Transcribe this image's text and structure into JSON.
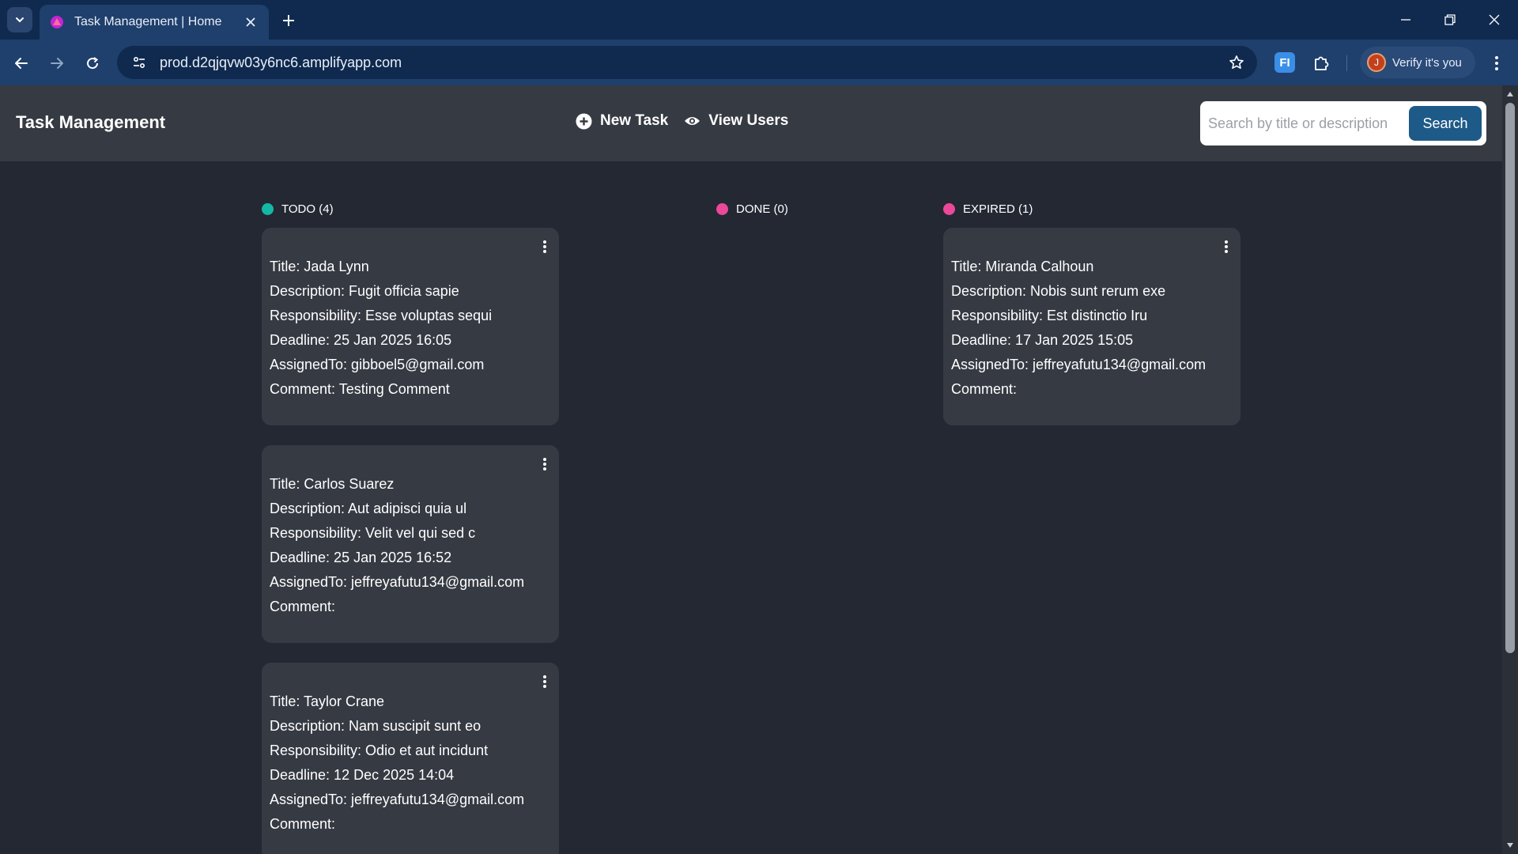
{
  "browser": {
    "tab_title": "Task Management | Home",
    "url": "prod.d2qjqvw03y6nc6.amplifyapp.com",
    "profile_label": "Verify it's you",
    "profile_initial": "J",
    "extension_label": "FI"
  },
  "app": {
    "title": "Task Management",
    "nav": {
      "new_task": "New Task",
      "view_users": "View Users"
    },
    "search": {
      "placeholder": "Search by title or description",
      "button": "Search"
    }
  },
  "columns": {
    "todo": {
      "label": "TODO (4)",
      "color": "#14b8a6"
    },
    "done": {
      "label": "DONE (0)",
      "color": "#ec4899"
    },
    "expired": {
      "label": "EXPIRED (1)",
      "color": "#ec4899"
    }
  },
  "cards": {
    "todo_1": {
      "title": "Title: Jada Lynn",
      "description": "Description: Fugit officia sapie",
      "responsibility": "Responsibility: Esse voluptas sequi",
      "deadline": "Deadline: 25 Jan 2025 16:05",
      "assigned": "AssignedTo: gibboel5@gmail.com",
      "comment": "Comment: Testing Comment"
    },
    "todo_2": {
      "title": "Title: Carlos Suarez",
      "description": "Description: Aut adipisci quia ul",
      "responsibility": "Responsibility: Velit vel qui sed c",
      "deadline": "Deadline: 25 Jan 2025 16:52",
      "assigned": "AssignedTo: jeffreyafutu134@gmail.com",
      "comment": "Comment:"
    },
    "todo_3": {
      "title": "Title: Taylor Crane",
      "description": "Description: Nam suscipit sunt eo",
      "responsibility": "Responsibility: Odio et aut incidunt",
      "deadline": "Deadline: 12 Dec 2025 14:04",
      "assigned": "AssignedTo: jeffreyafutu134@gmail.com",
      "comment": "Comment:"
    },
    "expired_1": {
      "title": "Title: Miranda Calhoun",
      "description": "Description: Nobis sunt rerum exe",
      "responsibility": "Responsibility: Est distinctio Iru",
      "deadline": "Deadline: 17 Jan 2025 15:05",
      "assigned": "AssignedTo: jeffreyafutu134@gmail.com",
      "comment": "Comment:"
    }
  }
}
